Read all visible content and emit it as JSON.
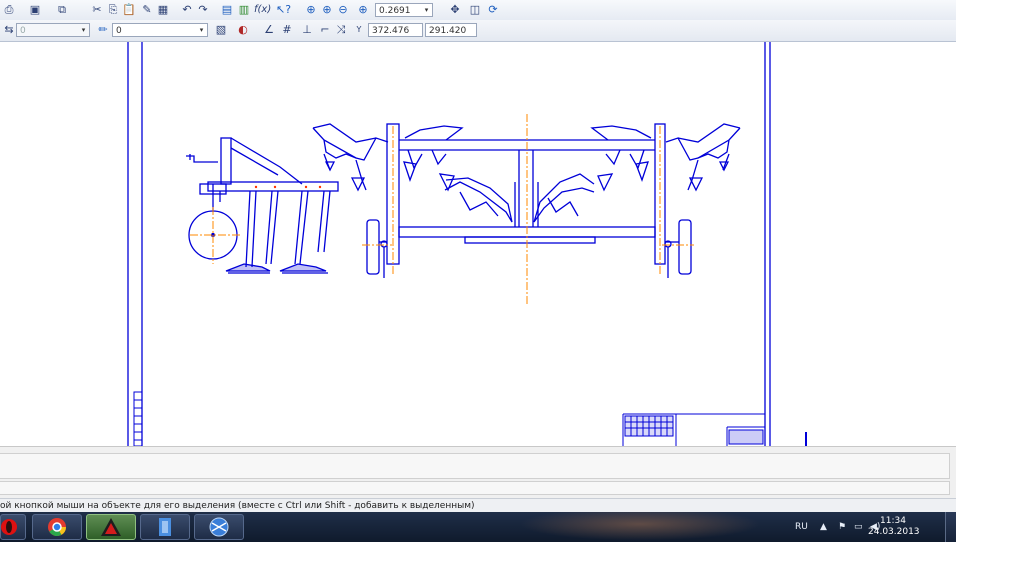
{
  "toolbar_top": {
    "zoom_value": "0.2691",
    "icons": [
      "print-icon",
      "print-preview-icon",
      "copy-format-icon",
      "cut-icon",
      "copy-icon",
      "paste-icon",
      "brush-icon",
      "table-icon",
      "undo-icon",
      "redo-icon",
      "calculator-icon",
      "variables-icon",
      "fx-icon",
      "help-pointer-icon",
      "zoom-window-icon",
      "zoom-in-icon",
      "zoom-out-icon",
      "zoom-scale-icon",
      "pan-icon",
      "layers-icon",
      "refresh-icon"
    ]
  },
  "toolbar_second": {
    "layer_value": "0",
    "style_value": "0",
    "coord_x": "372.476",
    "coord_y": "291.420",
    "coord_label": "Y"
  },
  "status": {
    "message": "ой кнопкой мыши на объекте для его выделения (вместе с Ctrl или Shift - добавить к выделенным)"
  },
  "taskbar": {
    "language": "RU",
    "time": "11:34",
    "date": "24.03.2013",
    "apps": [
      "opera-app",
      "chrome-app",
      "kompas-app",
      "file-app",
      "network-app"
    ]
  },
  "colors": {
    "drawing_line": "#0000d8",
    "axis_line": "#ff8a00",
    "taskbar": "#16233a"
  }
}
